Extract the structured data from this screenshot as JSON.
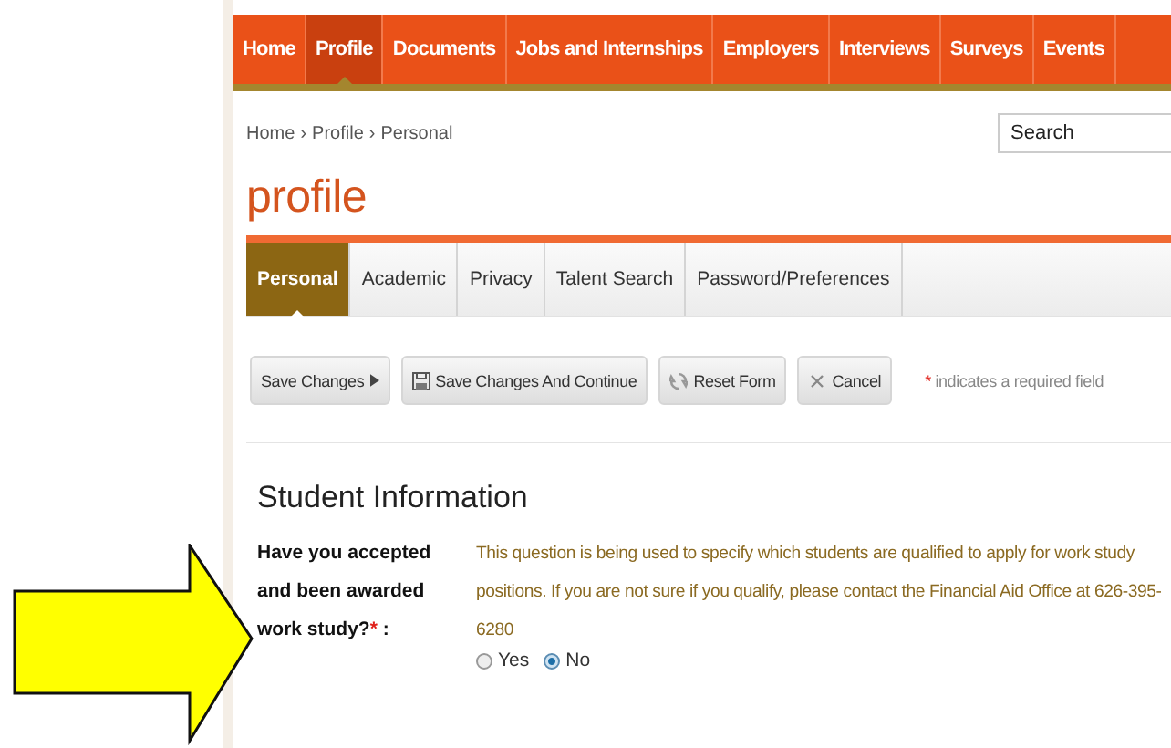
{
  "nav": {
    "items": [
      {
        "label": "Home",
        "selected": false
      },
      {
        "label": "Profile",
        "selected": true
      },
      {
        "label": "Documents",
        "selected": false
      },
      {
        "label": "Jobs and Internships",
        "selected": false
      },
      {
        "label": "Employers",
        "selected": false
      },
      {
        "label": "Interviews",
        "selected": false
      },
      {
        "label": "Surveys",
        "selected": false
      },
      {
        "label": "Events",
        "selected": false
      }
    ]
  },
  "breadcrumb": {
    "items": [
      "Home",
      "Profile",
      "Personal"
    ],
    "separator": "›"
  },
  "search": {
    "placeholder": "Search"
  },
  "page_title": "profile",
  "subtabs": [
    {
      "label": "Personal",
      "selected": true
    },
    {
      "label": "Academic",
      "selected": false
    },
    {
      "label": "Privacy",
      "selected": false
    },
    {
      "label": "Talent Search",
      "selected": false
    },
    {
      "label": "Password/Preferences",
      "selected": false
    }
  ],
  "toolbar": {
    "buttons": [
      {
        "label": "Save Changes",
        "kind": "save"
      },
      {
        "label": "Save Changes And Continue",
        "kind": "save_continue"
      },
      {
        "label": "Reset Form",
        "kind": "reset"
      },
      {
        "label": "Cancel",
        "kind": "cancel"
      }
    ],
    "required_note": {
      "marker": "*",
      "text": "indicates a required field"
    }
  },
  "section": {
    "title": "Student Information",
    "question": {
      "label": "Have you accepted and been awarded work study?",
      "required_marker": "*",
      "suffix": ":",
      "help": "This question is being used to specify which students are qualified to apply for work study positions. If you are not sure if you qualify, please contact the Financial Aid Office at 626-395-6280",
      "options": [
        {
          "label": "Yes",
          "selected": false
        },
        {
          "label": "No",
          "selected": true
        }
      ]
    }
  }
}
